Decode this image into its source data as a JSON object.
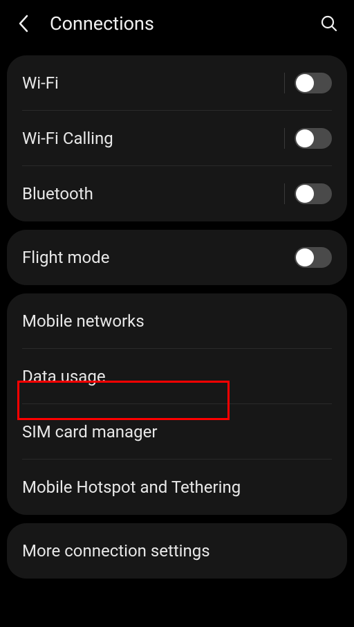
{
  "header": {
    "title": "Connections"
  },
  "sections": {
    "s1": {
      "wifi": "Wi-Fi",
      "wifi_calling": "Wi-Fi Calling",
      "bluetooth": "Bluetooth"
    },
    "s2": {
      "flight_mode": "Flight mode"
    },
    "s3": {
      "mobile_networks": "Mobile networks",
      "data_usage": "Data usage",
      "sim_manager": "SIM card manager",
      "hotspot": "Mobile Hotspot and Tethering"
    },
    "s4": {
      "more": "More connection settings"
    }
  },
  "toggles": {
    "wifi": false,
    "wifi_calling": false,
    "bluetooth": false,
    "flight_mode": false
  },
  "highlight": {
    "target": "data_usage",
    "color": "#ff0000"
  }
}
